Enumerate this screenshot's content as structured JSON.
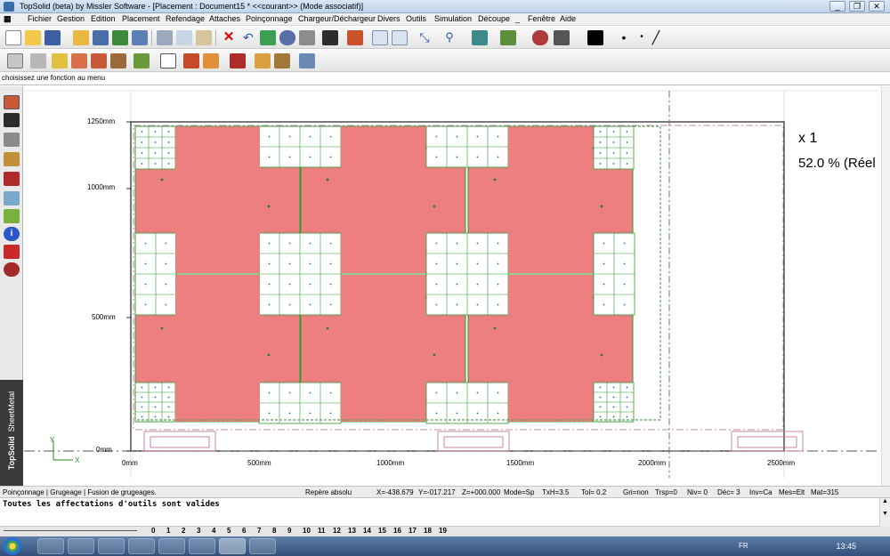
{
  "window": {
    "title": "TopSolid (beta) by Missler Software - [Placement : Document15 * <<courant>> (Mode associatif)]",
    "minimize": "_",
    "restore": "❐",
    "close": "✕"
  },
  "menu": [
    "Fichier",
    "Gestion",
    "Edition",
    "Placement",
    "Refendage",
    "Attaches",
    "Poinçonnage",
    "Chargeur/Déchargeur",
    "Divers",
    "Outils",
    "Simulation",
    "Découpe",
    "_",
    "Fenêtre",
    "Aide"
  ],
  "hint": "choisissez une fonction au menu",
  "sheetmetal_tab": {
    "brand": "TopSolid",
    "module": "SheetMetal"
  },
  "canvas": {
    "y_labels": [
      "1250mm",
      "1000mm",
      "500mm",
      "0mm"
    ],
    "x_labels": [
      "0mm",
      "500mm",
      "1000mm",
      "1500mm",
      "2000mm",
      "2500mm"
    ],
    "ratio_line1": "x 1",
    "ratio_line2": "52.0 % (Réel",
    "axis_y": "Y",
    "axis_x": "X"
  },
  "status": {
    "tools": "Poinçonnage | Grugeage | Fusion de grugeages.",
    "repere": "Repère absolu",
    "x": "X=-438.679",
    "y": "Y=-017.217",
    "z": "Z=+000.000",
    "mode": "Mode=Sp",
    "txh": "TxH=3.5",
    "tol": "Tol=  0.2",
    "gri": "Gri=non",
    "trsp": "Trsp=0",
    "niv": "Niv=  0",
    "dec": "Déc= 3",
    "inv": "Inv=Ca",
    "mes": "Mes=Elt",
    "mat": "Mat=315"
  },
  "message": "Toutes les affectations d'outils sont valides",
  "layers": [
    "0",
    "1",
    "2",
    "3",
    "4",
    "5",
    "6",
    "7",
    "8",
    "9",
    "10",
    "11",
    "12",
    "13",
    "14",
    "15",
    "16",
    "17",
    "18",
    "19"
  ],
  "taskbar": {
    "lang": "FR",
    "clock": "13:45"
  },
  "colors": {
    "part_fill": "#ed7f80",
    "part_border": "#2e9a2e",
    "sheet_outline": "#222222",
    "accent": "#3b6ea8"
  }
}
